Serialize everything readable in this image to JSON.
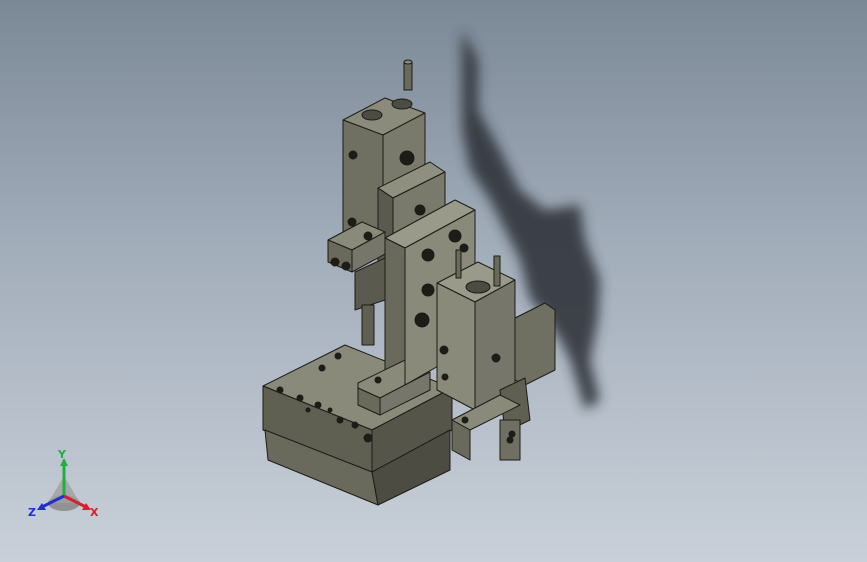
{
  "viewport": {
    "background_top": "#7b8896",
    "background_bottom": "#c9d0d9",
    "model_color": "#6e6e60",
    "shadow_color": "#2b2f36"
  },
  "triad": {
    "x_label": "X",
    "y_label": "Y",
    "z_label": "Z",
    "x_color": "#d8202a",
    "y_color": "#20b040",
    "z_color": "#2030d0"
  }
}
